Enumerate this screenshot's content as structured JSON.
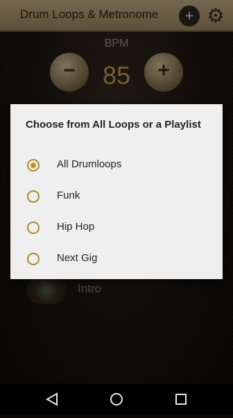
{
  "app": {
    "title": "Drum Loops & Metronome",
    "add_icon": "plus-circle-icon",
    "settings_icon": "gear-icon"
  },
  "bpm": {
    "label": "BPM",
    "value": "85",
    "minus": "−",
    "plus": "+"
  },
  "background_list": {
    "intro_label": "Intro"
  },
  "dialog": {
    "title": "Choose from All Loops or a Playlist",
    "options": [
      {
        "label": "All Drumloops",
        "checked": true
      },
      {
        "label": "Funk",
        "checked": false
      },
      {
        "label": "Hip Hop",
        "checked": false
      },
      {
        "label": "Next Gig",
        "checked": false
      }
    ]
  },
  "navbar": {
    "back_icon": "back-triangle-icon",
    "home_icon": "home-circle-icon",
    "recent_icon": "recents-square-icon"
  },
  "colors": {
    "accent": "#c8901e",
    "appbar": "#b8a276",
    "bpm_value": "#c8a24a",
    "dialog_bg": "#efefef"
  }
}
